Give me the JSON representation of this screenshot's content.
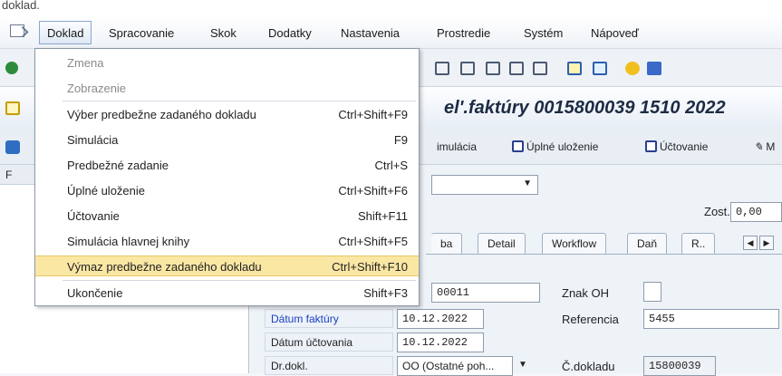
{
  "caption": "doklad.",
  "menubar": {
    "items": [
      "Doklad",
      "Spracovanie",
      "Skok",
      "Dodatky",
      "Nastavenia",
      "Prostredie",
      "Systém",
      "Nápoveď"
    ]
  },
  "title": "el'.faktúry 0015800039 1510 2022",
  "app_toolbar": {
    "simulation": "imulácia",
    "full_save": "Úplné uloženie",
    "posting": "Účtovanie",
    "more": "M"
  },
  "left_panel": {
    "letter": "F"
  },
  "zost": {
    "label": "Zost.",
    "value": "0,00"
  },
  "tabs": [
    "ba",
    "Detail",
    "Workflow",
    "Daň",
    "R.."
  ],
  "fields": {
    "code_value": "00011",
    "znak_oh_label": "Znak OH",
    "znak_oh_value": "",
    "datum_faktury_label": "Dátum faktúry",
    "datum_faktury_value": "10.12.2022",
    "referencia_label": "Referencia",
    "referencia_value": "5455",
    "datum_uctovania_label": "Dátum účtovania",
    "datum_uctovania_value": "10.12.2022",
    "dr_dokl_label": "Dr.dokl.",
    "dr_dokl_value": "OO (Ostatné poh...",
    "c_dokladu_label": "Č.dokladu",
    "c_dokladu_value": "15800039"
  },
  "dropdown": {
    "items": [
      {
        "label": "Zmena",
        "shortcut": "",
        "disabled": true
      },
      {
        "label": "Zobrazenie",
        "shortcut": "",
        "disabled": true
      },
      {
        "label": "Výber predbežne zadaného dokladu",
        "shortcut": "Ctrl+Shift+F9"
      },
      {
        "label": "Simulácia",
        "shortcut": "F9"
      },
      {
        "label": "Predbežné zadanie",
        "shortcut": "Ctrl+S"
      },
      {
        "label": "Úplné uloženie",
        "shortcut": "Ctrl+Shift+F6"
      },
      {
        "label": "Účtovanie",
        "shortcut": "Shift+F11"
      },
      {
        "label": "Simulácia hlavnej knihy",
        "shortcut": "Ctrl+Shift+F5"
      },
      {
        "label": "Výmaz predbežne zadaného dokladu",
        "shortcut": "Ctrl+Shift+F10",
        "highlighted": true
      },
      {
        "label": "Ukončenie",
        "shortcut": "Shift+F3"
      }
    ]
  },
  "colors": {
    "highlight": "#fbe7a4",
    "link_blue": "#1a3fc0",
    "title_text": "#1d2b44"
  }
}
